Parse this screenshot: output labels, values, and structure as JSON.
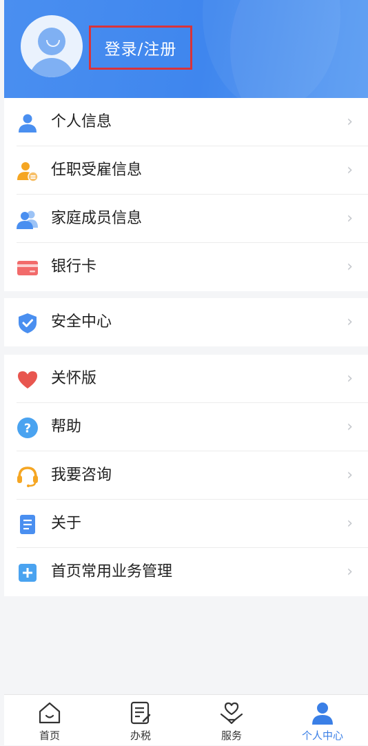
{
  "header": {
    "login_label": "登录/注册"
  },
  "menu_groups": [
    {
      "items": [
        {
          "label": "个人信息",
          "icon": "person-icon",
          "color": "#4a8ff0"
        },
        {
          "label": "任职受雇信息",
          "icon": "employment-icon",
          "color": "#f5a623"
        },
        {
          "label": "家庭成员信息",
          "icon": "family-icon",
          "color": "#4a8ff0"
        },
        {
          "label": "银行卡",
          "icon": "bank-card-icon",
          "color": "#f26b6b"
        }
      ]
    },
    {
      "items": [
        {
          "label": "安全中心",
          "icon": "shield-icon",
          "color": "#4a8ff0"
        }
      ]
    },
    {
      "items": [
        {
          "label": "关怀版",
          "icon": "heart-icon",
          "color": "#e8564f"
        },
        {
          "label": "帮助",
          "icon": "help-icon",
          "color": "#4aa3f0"
        },
        {
          "label": "我要咨询",
          "icon": "headset-icon",
          "color": "#f5a623"
        },
        {
          "label": "关于",
          "icon": "document-icon",
          "color": "#4a8ff0"
        },
        {
          "label": "首页常用业务管理",
          "icon": "plus-square-icon",
          "color": "#4aa3f0"
        }
      ]
    }
  ],
  "tabbar": {
    "tabs": [
      {
        "label": "首页",
        "icon": "home-icon",
        "active": false
      },
      {
        "label": "办税",
        "icon": "tax-form-icon",
        "active": false
      },
      {
        "label": "服务",
        "icon": "service-heart-icon",
        "active": false
      },
      {
        "label": "个人中心",
        "icon": "profile-icon",
        "active": true
      }
    ]
  },
  "colors": {
    "header_blue": "#4a8ff0",
    "active_tab": "#3a7fe6",
    "highlight_box": "#d9333a"
  }
}
